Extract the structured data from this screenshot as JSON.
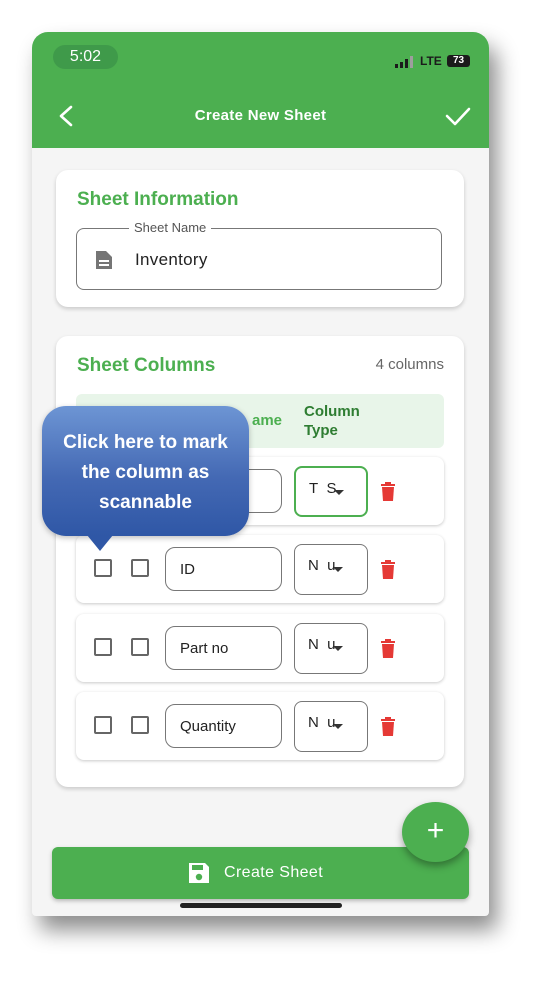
{
  "status_bar": {
    "time": "5:02",
    "network": "LTE",
    "battery": "73"
  },
  "app_bar": {
    "title": "Create New Sheet",
    "back_icon": "chevron-left-icon",
    "confirm_icon": "check-icon"
  },
  "sheet_info": {
    "title": "Sheet Information",
    "name_field": {
      "label": "Sheet Name",
      "value": "Inventory",
      "icon": "document-icon"
    }
  },
  "sheet_columns": {
    "title": "Sheet Columns",
    "count_label": "4 columns",
    "headers": {
      "name": "ame",
      "type": "Column Type"
    },
    "rows": [
      {
        "name": "",
        "type": "T  S"
      },
      {
        "name": "ID",
        "type": "N  u"
      },
      {
        "name": "Part no",
        "type": "N  u"
      },
      {
        "name": "Quantity",
        "type": "N  u"
      }
    ]
  },
  "fab": {
    "label": "+"
  },
  "create_button": {
    "label": "Create Sheet",
    "icon": "save-icon"
  },
  "callout": {
    "text": "Click here to mark the column as scannable"
  },
  "colors": {
    "primary": "#4caf50",
    "delete": "#e53935",
    "header_bg": "#e8f5e9",
    "callout": "#4469b4"
  }
}
